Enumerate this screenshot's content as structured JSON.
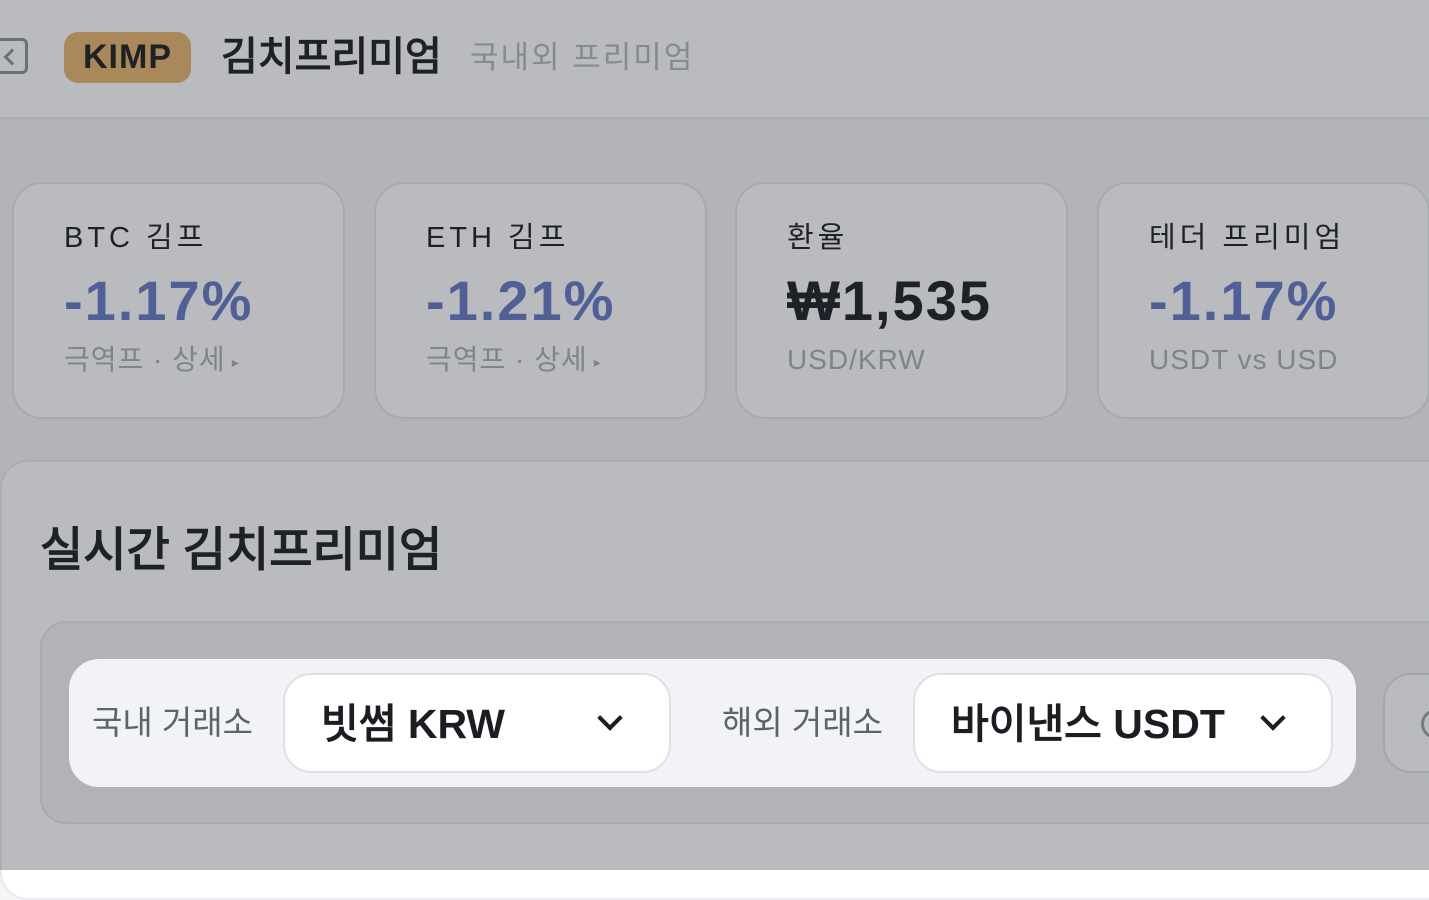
{
  "header": {
    "brand": "KIMP",
    "title": "김치프리미엄",
    "subtitle": "국내외 프리미엄"
  },
  "cards": [
    {
      "label": "BTC 김프",
      "value": "-1.17%",
      "sub": "극역프 · 상세"
    },
    {
      "label": "ETH 김프",
      "value": "-1.21%",
      "sub": "극역프 · 상세"
    },
    {
      "label": "환율",
      "value": "₩1,535",
      "sub": "USD/KRW"
    },
    {
      "label": "테더 프리미엄",
      "value": "-1.17%",
      "sub": "USDT vs USD"
    }
  ],
  "section": {
    "title": "실시간 김치프리미엄"
  },
  "toolbar": {
    "domestic_label": "국내 거래소",
    "domestic_value": "빗썸 KRW",
    "foreign_label": "해외 거래소",
    "foreign_value": "바이낸스 USDT"
  },
  "colors": {
    "brand": "#e6b56a",
    "premium_negative": "#6478c4"
  },
  "icons": {
    "back": "sidebar-collapse-icon",
    "detail_arrow": "triangle-right-icon",
    "dropdown": "chevron-down-icon",
    "search": "search-icon"
  }
}
